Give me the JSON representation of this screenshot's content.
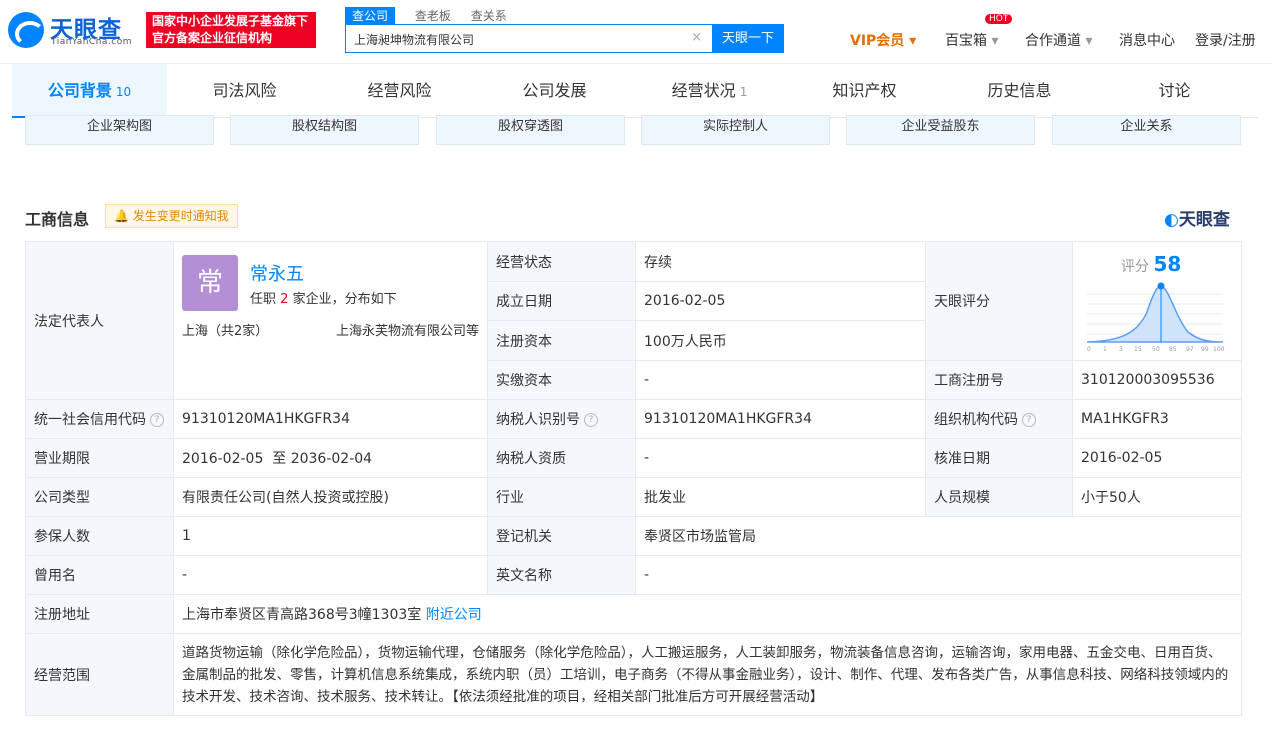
{
  "header": {
    "logo_text": "天眼查",
    "logo_sub": "TianYanCha.com",
    "badge_line1": "国家中小企业发展子基金旗下",
    "badge_line2": "官方备案企业征信机构",
    "search_tabs": [
      "查公司",
      "查老板",
      "查关系"
    ],
    "search_value": "上海昶坤物流有限公司",
    "search_button": "天眼一下",
    "vip": "VIP会员",
    "treasure": "百宝箱",
    "hot": "HOT",
    "cooperate": "合作通道",
    "messages": "消息中心",
    "login": "登录/注册"
  },
  "tabs": [
    {
      "label": "公司背景",
      "count": "10"
    },
    {
      "label": "司法风险",
      "count": ""
    },
    {
      "label": "经营风险",
      "count": ""
    },
    {
      "label": "公司发展",
      "count": ""
    },
    {
      "label": "经营状况",
      "count": "1"
    },
    {
      "label": "知识产权",
      "count": ""
    },
    {
      "label": "历史信息",
      "count": ""
    },
    {
      "label": "讨论",
      "count": ""
    }
  ],
  "sub_buttons": [
    "企业架构图",
    "股权结构图",
    "股权穿透图",
    "实际控制人",
    "企业受益股东",
    "企业关系"
  ],
  "section": {
    "title": "工商信息",
    "notify": "发生变更时通知我",
    "brand": "天眼查"
  },
  "legal": {
    "label": "法定代表人",
    "avatar": "常",
    "name": "常永五",
    "pre": "任职",
    "num": "2",
    "post": "家企业，分布如下",
    "region": "上海（共2家）",
    "company": "上海永芙物流有限公司等"
  },
  "info": {
    "status_k": "经营状态",
    "status_v": "存续",
    "found_k": "成立日期",
    "found_v": "2016-02-05",
    "capital_k": "注册资本",
    "capital_v": "100万人民币",
    "paid_k": "实缴资本",
    "paid_v": "-",
    "score_k": "天眼评分",
    "score_label": "评分",
    "score_value": "58",
    "score_ticks": [
      "0",
      "1",
      "3",
      "15",
      "50",
      "85",
      "97",
      "99",
      "100"
    ],
    "regno_k": "工商注册号",
    "regno_v": "310120003095536",
    "credit_k": "统一社会信用代码",
    "credit_v": "91310120MA1HKGFR34",
    "tax_k": "纳税人识别号",
    "tax_v": "91310120MA1HKGFR34",
    "org_k": "组织机构代码",
    "org_v": "MA1HKGFR3",
    "term_k": "营业期限",
    "term_v": "2016-02-05  至 2036-02-04",
    "taxq_k": "纳税人资质",
    "taxq_v": "-",
    "approve_k": "核准日期",
    "approve_v": "2016-02-05",
    "type_k": "公司类型",
    "type_v": "有限责任公司(自然人投资或控股)",
    "industry_k": "行业",
    "industry_v": "批发业",
    "staff_k": "人员规模",
    "staff_v": "小于50人",
    "insured_k": "参保人数",
    "insured_v": "1",
    "authority_k": "登记机关",
    "authority_v": "奉贤区市场监管局",
    "oldname_k": "曾用名",
    "oldname_v": "-",
    "english_k": "英文名称",
    "english_v": "-",
    "addr_k": "注册地址",
    "addr_v": "上海市奉贤区青高路368号3幢1303室",
    "addr_link": "附近公司",
    "scope_k": "经营范围",
    "scope_v": "道路货物运输（除化学危险品），货物运输代理，仓储服务（除化学危险品），人工搬运服务，人工装卸服务，物流装备信息咨询，运输咨询，家用电器、五金交电、日用百货、金属制品的批发、零售，计算机信息系统集成，系统内职（员）工培训，电子商务（不得从事金融业务），设计、制作、代理、发布各类广告，从事信息科技、网络科技领域内的技术开发、技术咨询、技术服务、技术转让。【依法须经批准的项目，经相关部门批准后方可开展经营活动】"
  },
  "colors": {
    "accent": "#0084ff",
    "red": "#e02",
    "vip": "#e26f00"
  }
}
